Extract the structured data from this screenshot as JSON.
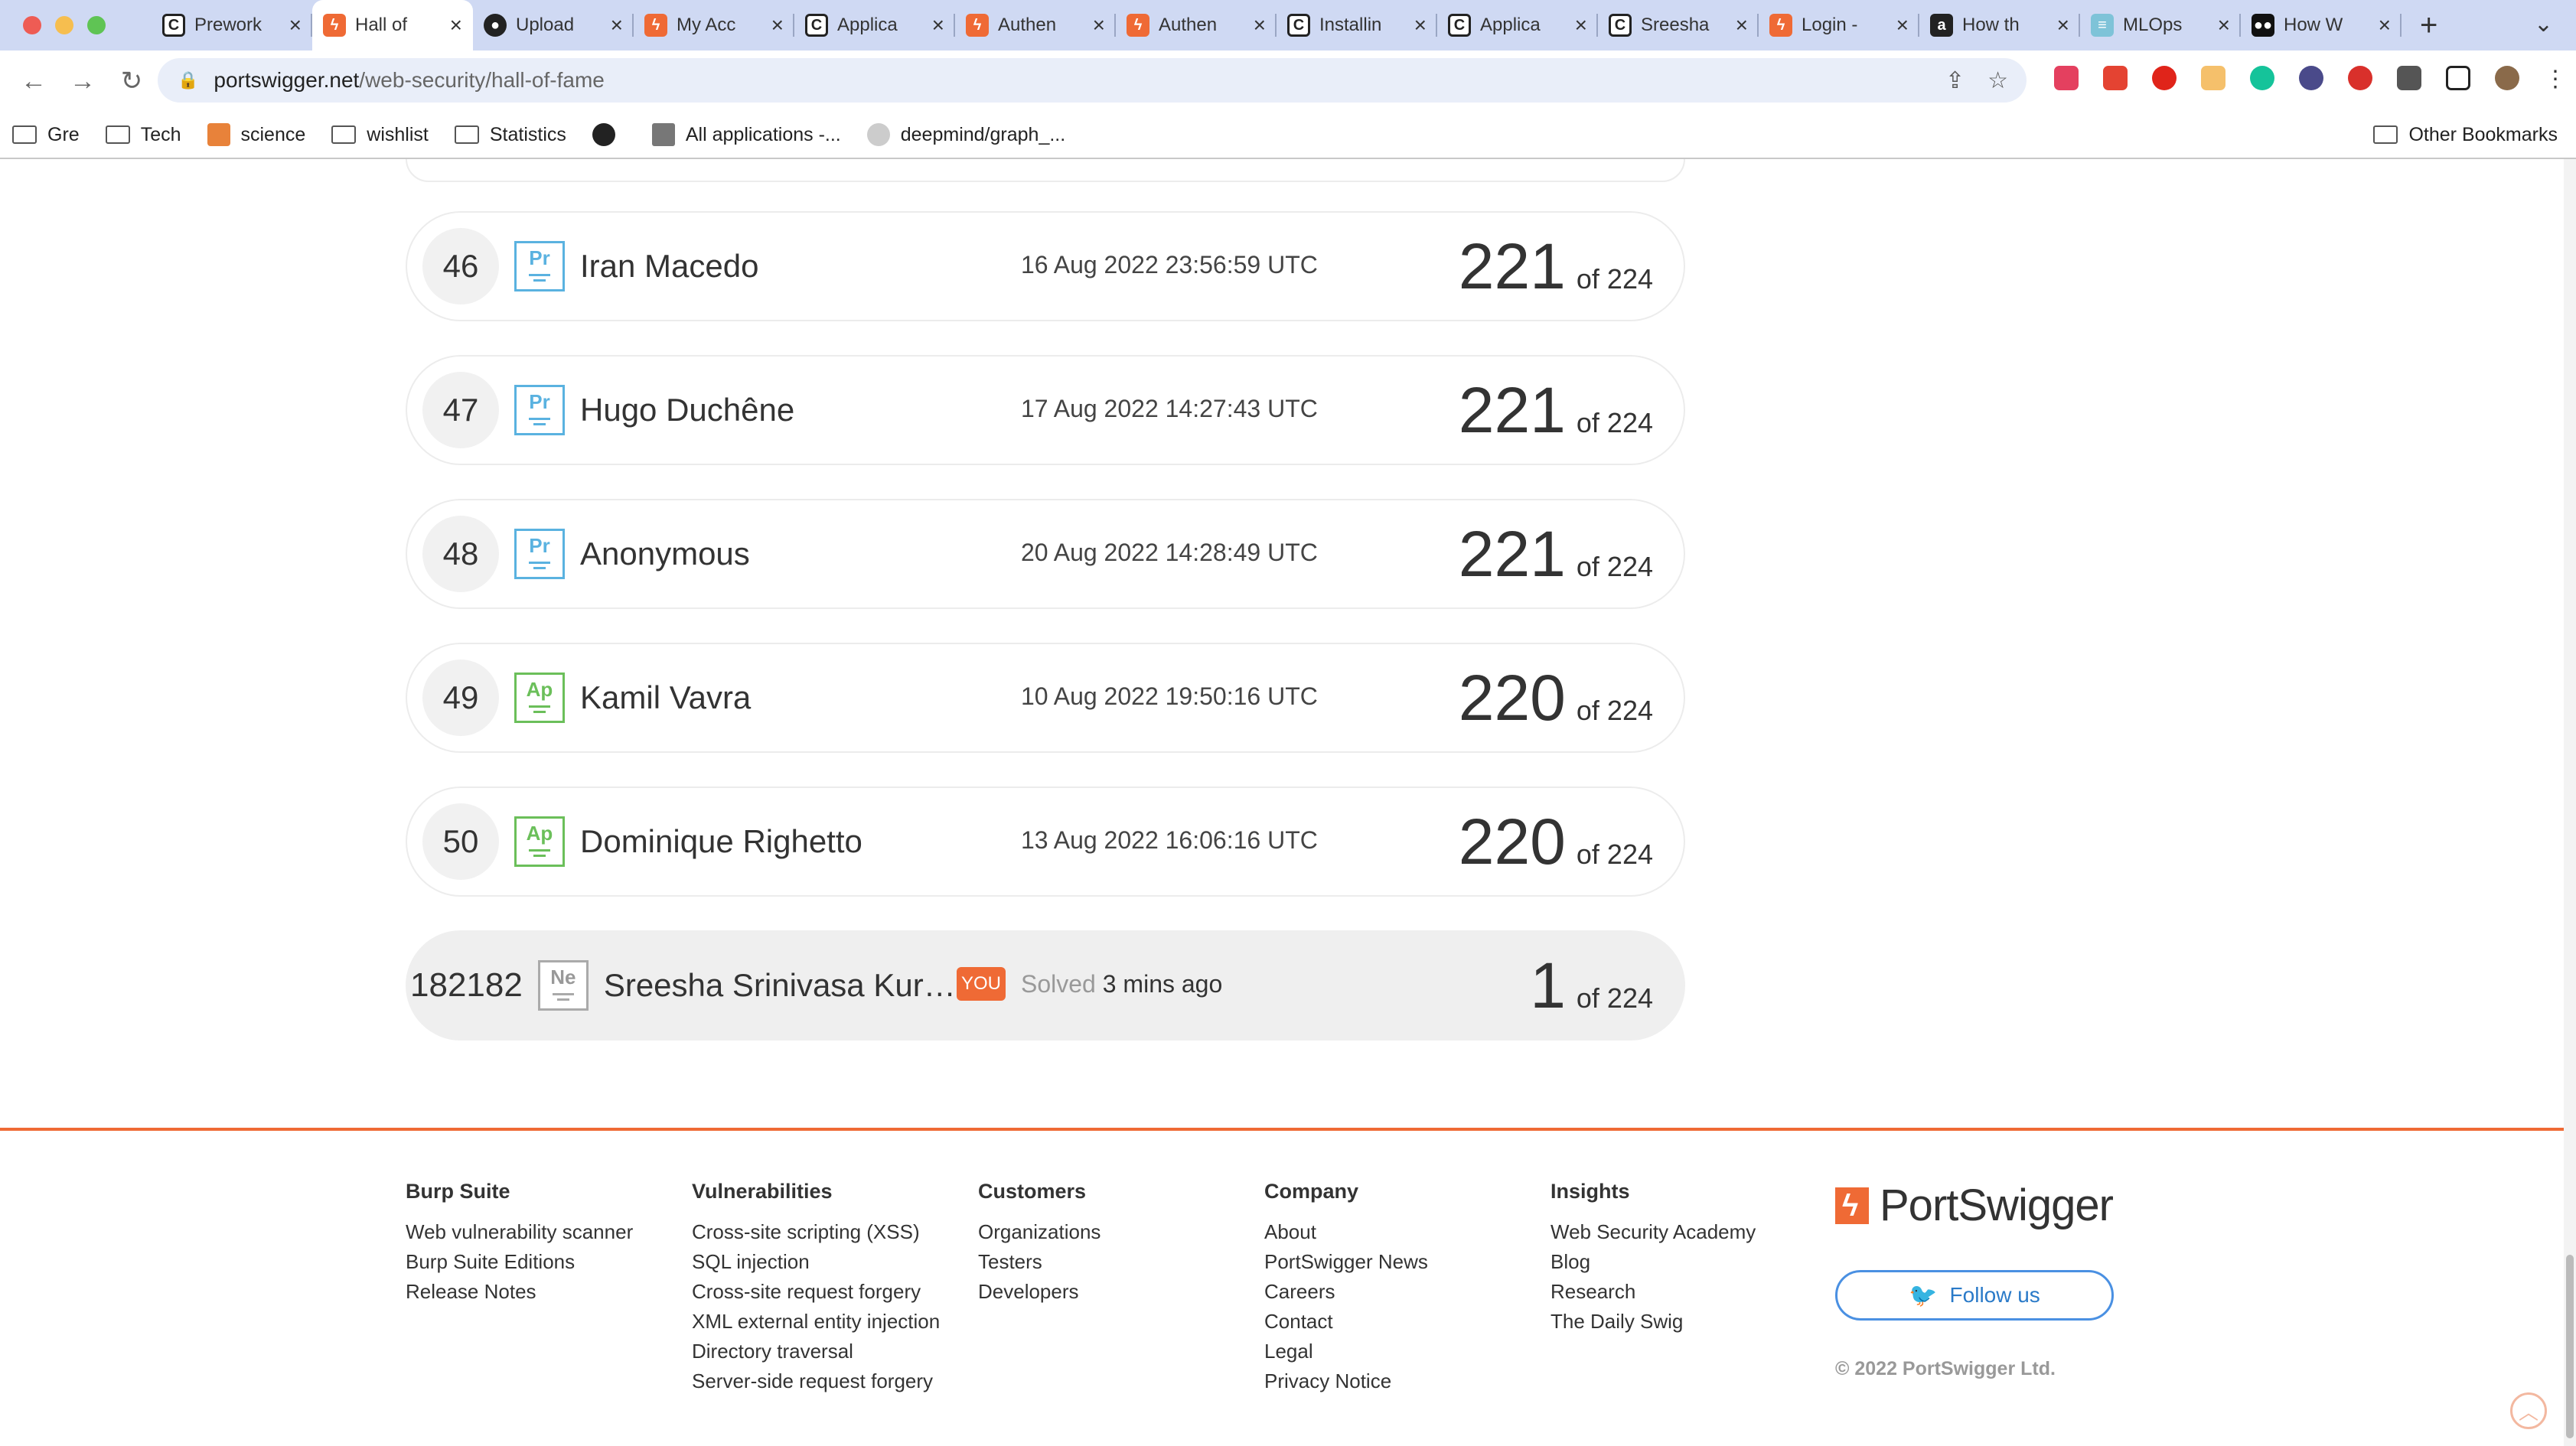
{
  "browser": {
    "tabs": [
      {
        "label": "Prework",
        "fav": "fav-c",
        "glyph": "C"
      },
      {
        "label": "Hall of",
        "fav": "fav-ps",
        "glyph": "ϟ"
      },
      {
        "label": "Upload",
        "fav": "fav-gh",
        "glyph": "●"
      },
      {
        "label": "My Acc",
        "fav": "fav-ps",
        "glyph": "ϟ"
      },
      {
        "label": "Applica",
        "fav": "fav-c",
        "glyph": "C"
      },
      {
        "label": "Authen",
        "fav": "fav-ps",
        "glyph": "ϟ"
      },
      {
        "label": "Authen",
        "fav": "fav-ps",
        "glyph": "ϟ"
      },
      {
        "label": "Installin",
        "fav": "fav-c",
        "glyph": "C"
      },
      {
        "label": "Applica",
        "fav": "fav-c",
        "glyph": "C"
      },
      {
        "label": "Sreesha",
        "fav": "fav-c",
        "glyph": "C"
      },
      {
        "label": "Login -",
        "fav": "fav-ps",
        "glyph": "ϟ"
      },
      {
        "label": "How th",
        "fav": "fav-a",
        "glyph": "a"
      },
      {
        "label": "MLOps",
        "fav": "fav-ml",
        "glyph": "≡"
      },
      {
        "label": "How W",
        "fav": "fav-md",
        "glyph": "●●"
      }
    ],
    "active_tab_index": 1,
    "url_host": "portswigger.net",
    "url_path": "/web-security/hall-of-fame",
    "bookmarks": [
      "Gre",
      "Tech",
      "science",
      "wishlist",
      "Statistics",
      "",
      "All applications -...",
      "deepmind/graph_..."
    ],
    "other_bookmarks": "Other Bookmarks"
  },
  "leaderboard": {
    "rows": [
      {
        "rank": "46",
        "badge": "Pr",
        "name": "Iran Macedo",
        "timestamp": "16 Aug 2022 23:56:59 UTC",
        "score": "221",
        "of": "of 224"
      },
      {
        "rank": "47",
        "badge": "Pr",
        "name": "Hugo Duchêne",
        "timestamp": "17 Aug 2022 14:27:43 UTC",
        "score": "221",
        "of": "of 224"
      },
      {
        "rank": "48",
        "badge": "Pr",
        "name": "Anonymous",
        "timestamp": "20 Aug 2022 14:28:49 UTC",
        "score": "221",
        "of": "of 224"
      },
      {
        "rank": "49",
        "badge": "Ap",
        "name": "Kamil Vavra",
        "timestamp": "10 Aug 2022 19:50:16 UTC",
        "score": "220",
        "of": "of 224"
      },
      {
        "rank": "50",
        "badge": "Ap",
        "name": "Dominique Righetto",
        "timestamp": "13 Aug 2022 16:06:16 UTC",
        "score": "220",
        "of": "of 224"
      }
    ],
    "you": {
      "rank": "182182",
      "badge": "Ne",
      "name": "Sreesha Srinivasa Kur…",
      "tag": "YOU",
      "solved_label": "Solved",
      "solved_ago": "3 mins ago",
      "score": "1",
      "of": "of 224"
    }
  },
  "footer": {
    "columns": [
      {
        "title": "Burp Suite",
        "links": [
          "Web vulnerability scanner",
          "Burp Suite Editions",
          "Release Notes"
        ]
      },
      {
        "title": "Vulnerabilities",
        "links": [
          "Cross-site scripting (XSS)",
          "SQL injection",
          "Cross-site request forgery",
          "XML external entity injection",
          "Directory traversal",
          "Server-side request forgery"
        ]
      },
      {
        "title": "Customers",
        "links": [
          "Organizations",
          "Testers",
          "Developers"
        ]
      },
      {
        "title": "Company",
        "links": [
          "About",
          "PortSwigger News",
          "Careers",
          "Contact",
          "Legal",
          "Privacy Notice"
        ]
      },
      {
        "title": "Insights",
        "links": [
          "Web Security Academy",
          "Blog",
          "Research",
          "The Daily Swig"
        ]
      }
    ],
    "logo_text": "PortSwigger",
    "follow_label": "Follow us",
    "copyright": "© 2022 PortSwigger Ltd."
  },
  "colors": {
    "accent": "#ef6a35",
    "practitioner": "#5ab2e0",
    "apprentice": "#6bbf5a"
  }
}
